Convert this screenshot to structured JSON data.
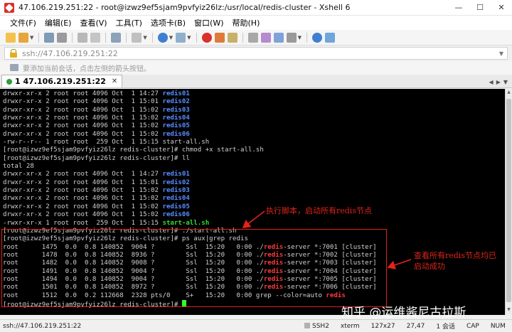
{
  "window": {
    "title": "47.106.219.251:22 - root@izwz9ef5sjam9pvfyiz26lz:/usr/local/redis-cluster - Xshell 6",
    "controls": {
      "minimize": "—",
      "maximize": "☐",
      "close": "✕"
    }
  },
  "menu": {
    "items": [
      "文件(F)",
      "编辑(E)",
      "查看(V)",
      "工具(T)",
      "选项卡(B)",
      "窗口(W)",
      "帮助(H)"
    ]
  },
  "address": {
    "value": "ssh://47.106.219.251:22"
  },
  "hint": {
    "text": "要添加当前会话，点击左侧的箭头按钮。"
  },
  "tabs": [
    {
      "label": "1 47.106.219.251:22",
      "close": "✕"
    }
  ],
  "terminal": {
    "lines": [
      [
        {
          "t": "drwxr-xr-x 2 root root 4096 Oct  1 14:27 "
        },
        {
          "t": "redis01",
          "c": "dir"
        }
      ],
      [
        {
          "t": "drwxr-xr-x 2 root root 4096 Oct  1 15:01 "
        },
        {
          "t": "redis02",
          "c": "dir"
        }
      ],
      [
        {
          "t": "drwxr-xr-x 2 root root 4096 Oct  1 15:02 "
        },
        {
          "t": "redis03",
          "c": "dir"
        }
      ],
      [
        {
          "t": "drwxr-xr-x 2 root root 4096 Oct  1 15:02 "
        },
        {
          "t": "redis04",
          "c": "dir"
        }
      ],
      [
        {
          "t": "drwxr-xr-x 2 root root 4096 Oct  1 15:02 "
        },
        {
          "t": "redis05",
          "c": "dir"
        }
      ],
      [
        {
          "t": "drwxr-xr-x 2 root root 4096 Oct  1 15:02 "
        },
        {
          "t": "redis06",
          "c": "dir"
        }
      ],
      [
        {
          "t": "-rw-r--r-- 1 root root  259 Oct  1 15:15 start-all.sh"
        }
      ],
      [
        {
          "t": "[root@izwz9ef5sjam9pvfyiz26lz redis-cluster]# chmod +x start-all.sh"
        }
      ],
      [
        {
          "t": "[root@izwz9ef5sjam9pvfyiz26lz redis-cluster]# ll"
        }
      ],
      [
        {
          "t": "total 28"
        }
      ],
      [
        {
          "t": "drwxr-xr-x 2 root root 4096 Oct  1 14:27 "
        },
        {
          "t": "redis01",
          "c": "dir"
        }
      ],
      [
        {
          "t": "drwxr-xr-x 2 root root 4096 Oct  1 15:01 "
        },
        {
          "t": "redis02",
          "c": "dir"
        }
      ],
      [
        {
          "t": "drwxr-xr-x 2 root root 4096 Oct  1 15:02 "
        },
        {
          "t": "redis03",
          "c": "dir"
        }
      ],
      [
        {
          "t": "drwxr-xr-x 2 root root 4096 Oct  1 15:02 "
        },
        {
          "t": "redis04",
          "c": "dir"
        }
      ],
      [
        {
          "t": "drwxr-xr-x 2 root root 4096 Oct  1 15:02 "
        },
        {
          "t": "redis05",
          "c": "dir"
        }
      ],
      [
        {
          "t": "drwxr-xr-x 2 root root 4096 Oct  1 15:02 "
        },
        {
          "t": "redis06",
          "c": "dir"
        }
      ],
      [
        {
          "t": "-rwxr-xr-x 1 root root  259 Oct  1 15:15 "
        },
        {
          "t": "start-all.sh",
          "c": "exe"
        }
      ],
      [
        {
          "t": "[root@izwz9ef5sjam9pvfyiz26lz redis-cluster]# ./start-all.sh"
        }
      ],
      [
        {
          "t": "[root@izwz9ef5sjam9pvfyiz26lz redis-cluster]# ps aux|grep redis"
        }
      ],
      [
        {
          "t": "root      1475  0.0  0.8 140852  9004 ?        Ssl  15:20   0:00 ./"
        },
        {
          "t": "redis",
          "c": "hl"
        },
        {
          "t": "-server *:7001 [cluster]"
        }
      ],
      [
        {
          "t": "root      1478  0.0  0.8 140852  8936 ?        Ssl  15:20   0:00 ./"
        },
        {
          "t": "redis",
          "c": "hl"
        },
        {
          "t": "-server *:7002 [cluster]"
        }
      ],
      [
        {
          "t": "root      1482  0.0  0.8 140852  9008 ?        Ssl  15:20   0:00 ./"
        },
        {
          "t": "redis",
          "c": "hl"
        },
        {
          "t": "-server *:7003 [cluster]"
        }
      ],
      [
        {
          "t": "root      1491  0.0  0.8 140852  9004 ?        Ssl  15:20   0:00 ./"
        },
        {
          "t": "redis",
          "c": "hl"
        },
        {
          "t": "-server *:7004 [cluster]"
        }
      ],
      [
        {
          "t": "root      1494  0.0  0.8 140852  9004 ?        Ssl  15:20   0:00 ./"
        },
        {
          "t": "redis",
          "c": "hl"
        },
        {
          "t": "-server *:7005 [cluster]"
        }
      ],
      [
        {
          "t": "root      1501  0.0  0.8 140852  8972 ?        Ssl  15:20   0:00 ./"
        },
        {
          "t": "redis",
          "c": "hl"
        },
        {
          "t": "-server *:7006 [cluster]"
        }
      ],
      [
        {
          "t": "root      1512  0.0  0.2 112668  2328 pts/0    S+   15:20   0:00 grep --color=auto "
        },
        {
          "t": "redis",
          "c": "hl"
        }
      ],
      [
        {
          "t": "[root@izwz9ef5sjam9pvfyiz26lz redis-cluster]# "
        },
        {
          "t": "",
          "c": "cursor"
        }
      ]
    ]
  },
  "annotations": {
    "run_script": "执行脚本，启动所有redis节点",
    "check_nodes": "查看所有redis节点均已启动成功",
    "color": "#e0241a"
  },
  "watermark": "知乎 @运维酱尼古拉斯",
  "status": {
    "address": "ssh://47.106.219.251:22",
    "items": [
      "SSH2",
      "xterm",
      "127x27",
      "27,47",
      "1 会话",
      "CAP",
      "NUM"
    ]
  }
}
